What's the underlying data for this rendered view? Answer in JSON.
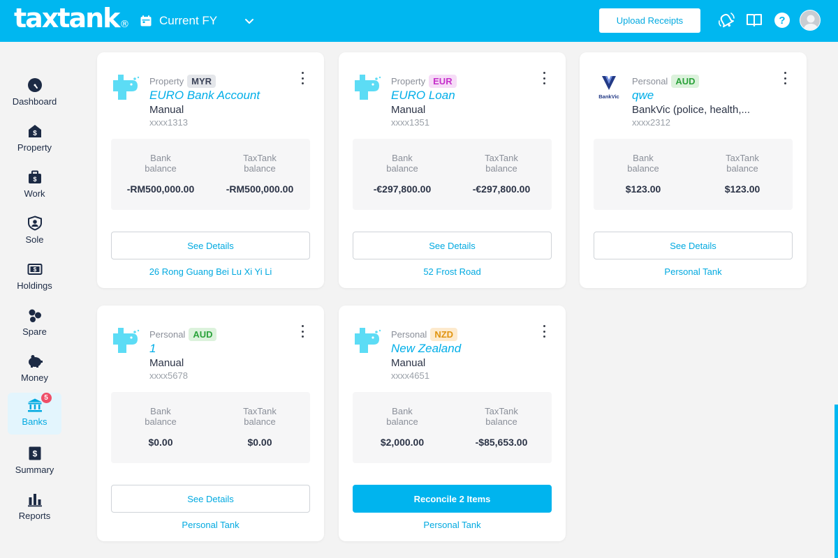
{
  "header": {
    "logo_text": "taxtank",
    "logo_mark": "®",
    "fy_label": "Current FY",
    "upload_label": "Upload Receipts",
    "icons": [
      "calendar-icon",
      "chevron-down-icon",
      "notification-bell-icon",
      "book-icon",
      "help-icon",
      "avatar"
    ]
  },
  "sidebar": {
    "items": [
      {
        "label": "Dashboard",
        "icon": "dashboard-icon"
      },
      {
        "label": "Property",
        "icon": "property-icon"
      },
      {
        "label": "Work",
        "icon": "briefcase-icon"
      },
      {
        "label": "Sole",
        "icon": "sole-icon"
      },
      {
        "label": "Holdings",
        "icon": "holdings-icon"
      },
      {
        "label": "Spare",
        "icon": "spare-icon"
      },
      {
        "label": "Money",
        "icon": "piggy-bank-icon"
      },
      {
        "label": "Banks",
        "icon": "bank-icon",
        "badge": "5",
        "active": true
      },
      {
        "label": "Summary",
        "icon": "summary-icon"
      },
      {
        "label": "Reports",
        "icon": "reports-icon"
      }
    ]
  },
  "labels": {
    "bank_balance": "Bank balance",
    "taxtank_balance": "TaxTank balance"
  },
  "cards": [
    {
      "type": "Property",
      "currency": "MYR",
      "name": "EURO Bank Account",
      "sub": "Manual",
      "number": "xxxx1313",
      "bank_balance": "-RM500,000.00",
      "taxtank_balance": "-RM500,000.00",
      "button": "See Details",
      "tank": "26 Rong Guang Bei Lu Xi Yi Li",
      "icon": "taxtank-logo-icon"
    },
    {
      "type": "Property",
      "currency": "EUR",
      "name": "EURO Loan",
      "sub": "Manual",
      "number": "xxxx1351",
      "bank_balance": "-€297,800.00",
      "taxtank_balance": "-€297,800.00",
      "button": "See Details",
      "tank": "52 Frost Road",
      "icon": "taxtank-logo-icon"
    },
    {
      "type": "Personal",
      "currency": "AUD",
      "name": "qwe",
      "sub": "BankVic (police, health,...",
      "number": "xxxx2312",
      "bank_balance": "$123.00",
      "taxtank_balance": "$123.00",
      "button": "See Details",
      "tank": "Personal Tank",
      "icon": "bankvic-logo-icon",
      "logo_text": "BankVic"
    },
    {
      "type": "Personal",
      "currency": "AUD",
      "name": "1",
      "sub": "Manual",
      "number": "xxxx5678",
      "bank_balance": "$0.00",
      "taxtank_balance": "$0.00",
      "button": "See Details",
      "tank": "Personal Tank",
      "icon": "taxtank-logo-icon"
    },
    {
      "type": "Personal",
      "currency": "NZD",
      "name": "New Zealand",
      "sub": "Manual",
      "number": "xxxx4651",
      "bank_balance": "$2,000.00",
      "taxtank_balance": "-$85,653.00",
      "button": "Reconcile 2 Items",
      "tank": "Personal Tank",
      "icon": "taxtank-logo-icon"
    }
  ],
  "colors": {
    "brand": "#00b7f0",
    "link": "#00a9e0",
    "badge": "#ef4f67",
    "myr": "#3b4358",
    "eur": "#c52fca",
    "aud": "#2aa23a",
    "nzd": "#e09410"
  }
}
